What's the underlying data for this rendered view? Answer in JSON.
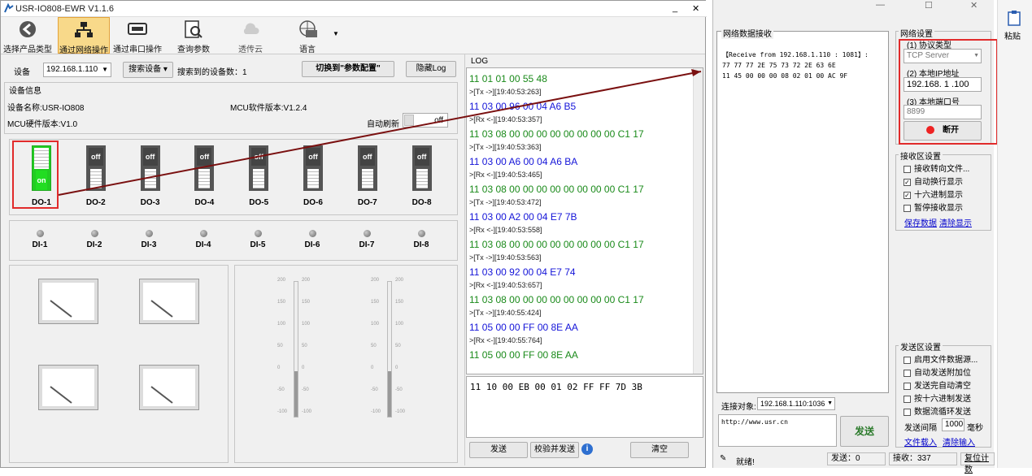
{
  "app": {
    "title": "USR-IO808-EWR V1.1.6"
  },
  "toolbar": [
    {
      "label": "选择产品类型",
      "icon": "back-arrow-icon"
    },
    {
      "label": "通过网络操作",
      "icon": "network-icon",
      "selected": true
    },
    {
      "label": "通过串口操作",
      "icon": "serial-port-icon"
    },
    {
      "label": "查询参数",
      "icon": "query-icon"
    },
    {
      "label": "透传云",
      "icon": "cloud-icon"
    },
    {
      "label": "语言",
      "icon": "globe-icon"
    }
  ],
  "device_row": {
    "device_label": "设备",
    "device_value": "192.168.1.110",
    "search_button": "搜索设备",
    "found_text": "搜索到的设备数：1",
    "switch_button": "切换到\"参数配置\"",
    "hide_log_button": "隐藏Log"
  },
  "device_info": {
    "section": "设备信息",
    "name": "设备名称:USR-IO808",
    "mcu_sw": "MCU软件版本:V1.2.4",
    "mcu_hw": "MCU硬件版本:V1.0",
    "auto_refresh": "自动刷新",
    "toggle": "off"
  },
  "do": [
    {
      "label": "DO-1",
      "state": "on"
    },
    {
      "label": "DO-2",
      "state": "off"
    },
    {
      "label": "DO-3",
      "state": "off"
    },
    {
      "label": "DO-4",
      "state": "off"
    },
    {
      "label": "DO-5",
      "state": "off"
    },
    {
      "label": "DO-6",
      "state": "off"
    },
    {
      "label": "DO-7",
      "state": "off"
    },
    {
      "label": "DO-8",
      "state": "off"
    }
  ],
  "di": [
    "DI-1",
    "DI-2",
    "DI-3",
    "DI-4",
    "DI-5",
    "DI-6",
    "DI-7",
    "DI-8"
  ],
  "thermo_ticks": [
    "200",
    "150",
    "100",
    "50",
    "0",
    "-50",
    "-100"
  ],
  "log": {
    "title": "LOG",
    "lines": [
      {
        "t": "11 01 01 00 55 48",
        "c": "g"
      },
      {
        "t": ">[Tx ->][19:40:53:263]",
        "c": "ts"
      },
      {
        "t": "11 03 00 96 00 04 A6 B5",
        "c": "b"
      },
      {
        "t": ">[Rx <-][19:40:53:357]",
        "c": "ts"
      },
      {
        "t": "11 03 08 00 00 00 00 00 00 00 00 C1 17",
        "c": "g"
      },
      {
        "t": ">[Tx ->][19:40:53:363]",
        "c": "ts"
      },
      {
        "t": "11 03 00 A6 00 04 A6 BA",
        "c": "b"
      },
      {
        "t": ">[Rx <-][19:40:53:465]",
        "c": "ts"
      },
      {
        "t": "11 03 08 00 00 00 00 00 00 00 00 C1 17",
        "c": "g"
      },
      {
        "t": ">[Tx ->][19:40:53:472]",
        "c": "ts"
      },
      {
        "t": "11 03 00 A2 00 04 E7 7B",
        "c": "b"
      },
      {
        "t": ">[Rx <-][19:40:53:558]",
        "c": "ts"
      },
      {
        "t": "11 03 08 00 00 00 00 00 00 00 00 C1 17",
        "c": "g"
      },
      {
        "t": ">[Tx ->][19:40:53:563]",
        "c": "ts"
      },
      {
        "t": "11 03 00 92 00 04 E7 74",
        "c": "b"
      },
      {
        "t": ">[Rx <-][19:40:53:657]",
        "c": "ts"
      },
      {
        "t": "11 03 08 00 00 00 00 00 00 00 00 C1 17",
        "c": "g"
      },
      {
        "t": ">[Tx ->][19:40:55:424]",
        "c": "ts"
      },
      {
        "t": "11 05 00 00 FF 00 8E AA",
        "c": "b"
      },
      {
        "t": ">[Rx <-][19:40:55:764]",
        "c": "ts"
      },
      {
        "t": "11 05 00 00 FF 00 8E AA",
        "c": "g"
      }
    ],
    "send_text": "11 10 00 EB 00 01 02 FF FF 7D 3B",
    "send_button": "发送",
    "verify_button": "校验并发送",
    "clear_button": "清空"
  },
  "net": {
    "recv_title": "网络数据接收",
    "recv_lines": [
      "【Receive from 192.168.1.110 : 1081】:",
      "77 77 77 2E 75 73 72 2E 63 6E",
      "11 45 00 00 00 08 02 01 00 AC 9F"
    ],
    "settings_title": "网络设置",
    "proto_label": "(1) 协议类型",
    "proto_value": "TCP Server",
    "ip_label": "(2) 本地IP地址",
    "ip_value": "192.168. 1 .100",
    "port_label": "(3) 本地端口号",
    "port_value": "8899",
    "disconnect": "断开",
    "recv_settings": "接收区设置",
    "recv_opts": [
      {
        "label": "接收转向文件...",
        "checked": false
      },
      {
        "label": "自动换行显示",
        "checked": true
      },
      {
        "label": "十六进制显示",
        "checked": true
      },
      {
        "label": "暂停接收显示",
        "checked": false
      }
    ],
    "save_data": "保存数据",
    "clear_display": "清除显示",
    "send_settings": "发送区设置",
    "send_opts": [
      {
        "label": "启用文件数据源...",
        "checked": false
      },
      {
        "label": "自动发送附加位",
        "checked": false
      },
      {
        "label": "发送完自动清空",
        "checked": false
      },
      {
        "label": "按十六进制发送",
        "checked": false
      },
      {
        "label": "数据流循环发送",
        "checked": false
      }
    ],
    "interval_label": "发送间隔",
    "interval_value": "1000",
    "interval_unit": "毫秒",
    "file_load": "文件载入",
    "clear_input": "清除输入",
    "target_label": "连接对象:",
    "target_value": "192.168.1.110:1036",
    "send_text": "http://www.usr.cn",
    "send_button": "发送",
    "status": "就绪!",
    "sent": "发送：0",
    "received": "接收：337",
    "reset": "复位计数"
  },
  "side": {
    "paste": "粘贴"
  }
}
